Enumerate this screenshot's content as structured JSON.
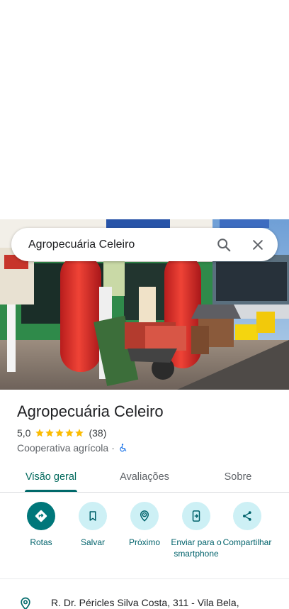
{
  "search": {
    "query": "Agropecuária Celeiro",
    "search_icon": "search-icon",
    "close_icon": "close-icon"
  },
  "place": {
    "name": "Agropecuária Celeiro",
    "rating": "5,0",
    "stars": 5,
    "review_count": "(38)",
    "category": "Cooperativa agrícola",
    "separator": "·",
    "accessibility_icon": "wheelchair-icon"
  },
  "tabs": [
    {
      "label": "Visão geral",
      "active": true
    },
    {
      "label": "Avaliações",
      "active": false
    },
    {
      "label": "Sobre",
      "active": false
    }
  ],
  "actions": [
    {
      "label": "Rotas",
      "icon": "directions-icon"
    },
    {
      "label": "Salvar",
      "icon": "bookmark-icon"
    },
    {
      "label": "Próximo",
      "icon": "nearby-icon"
    },
    {
      "label": "Enviar para o smartphone",
      "icon": "send-to-phone-icon"
    },
    {
      "label": "Compartilhar",
      "icon": "share-icon"
    }
  ],
  "address": {
    "text": "R. Dr. Péricles Silva Costa, 311 - Vila Bela,",
    "icon": "location-pin-icon"
  },
  "colors": {
    "accent": "#00696a",
    "action_bg": "#cdf0f5",
    "primary_action_bg": "#00777a",
    "star": "#fbbc04"
  }
}
